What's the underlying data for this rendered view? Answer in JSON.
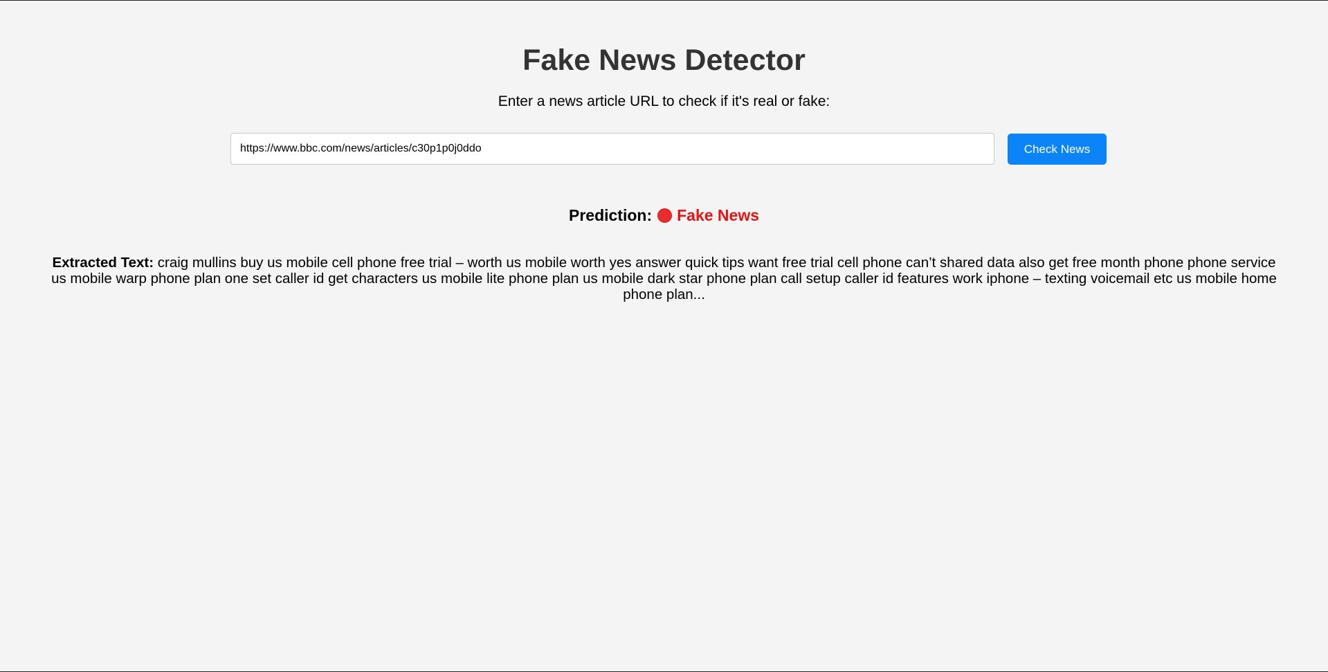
{
  "page": {
    "title": "Fake News Detector",
    "instructions": "Enter a news article URL to check if it's real or fake:"
  },
  "form": {
    "url_value": "https://www.bbc.com/news/articles/c30p1p0j0ddo",
    "check_button_label": "Check News"
  },
  "prediction": {
    "label": "Prediction:",
    "icon": "red-circle-icon",
    "result": "Fake News",
    "result_color": "#e81414"
  },
  "extracted": {
    "label": "Extracted Text:",
    "text": "craig mullins buy us mobile cell phone free trial – worth us mobile worth yes answer quick tips want free trial cell phone can’t shared data also get free month phone phone service us mobile warp phone plan one set caller id get characters us mobile lite phone plan us mobile dark star phone plan call setup caller id features work iphone – texting voicemail etc us mobile home phone plan..."
  },
  "colors": {
    "background": "#f4f4f4",
    "title": "#333333",
    "button": "#0a84f6"
  }
}
